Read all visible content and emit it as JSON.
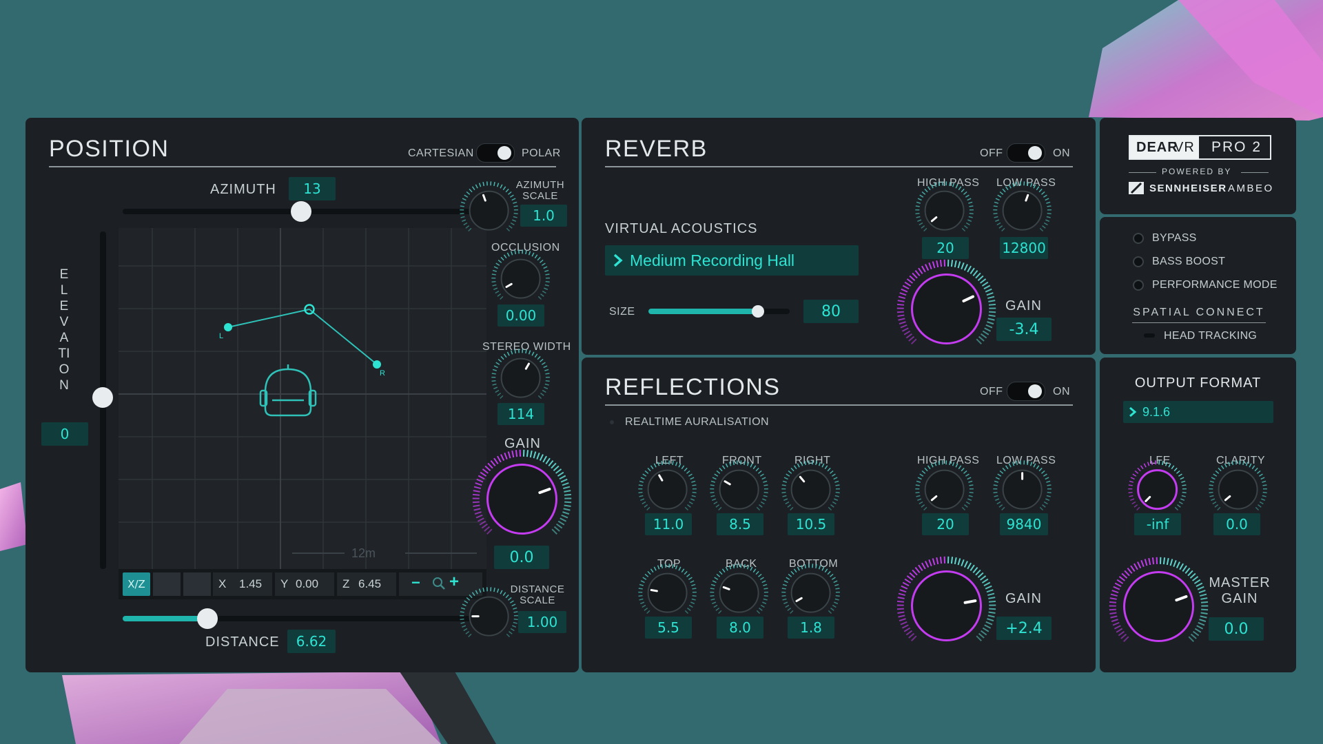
{
  "position": {
    "title": "POSITION",
    "mode_left": "CARTESIAN",
    "mode_right": "POLAR",
    "azimuth_label": "AZIMUTH",
    "azimuth_value": "13",
    "azimuth_scale_label": "AZIMUTH SCALE",
    "azimuth_scale_value": "1.0",
    "occlusion_label": "OCCLUSION",
    "occlusion_value": "0.00",
    "stereo_width_label": "STEREO WIDTH",
    "stereo_width_value": "114",
    "gain_label": "GAIN",
    "gain_value": "0.0",
    "distance_scale_label": "DISTANCE SCALE",
    "distance_scale_value": "1.00",
    "distance_label": "DISTANCE",
    "distance_value": "6.62",
    "elevation_label": "ELEVATION",
    "elevation_value": "0",
    "grid_scale": "12m",
    "view_button": "X/Z",
    "x_label": "X",
    "x_value": "1.45",
    "y_label": "Y",
    "y_value": "0.00",
    "z_label": "Z",
    "z_value": "6.45",
    "zoom_out": "−",
    "zoom_in": "+",
    "left_marker": "L",
    "right_marker": "R"
  },
  "reverb": {
    "title": "REVERB",
    "off": "OFF",
    "on": "ON",
    "virtual_acoustics_label": "VIRTUAL ACOUSTICS",
    "preset": "Medium Recording Hall",
    "size_label": "SIZE",
    "size_value": "80",
    "high_pass_label": "HIGH PASS",
    "high_pass_value": "20",
    "low_pass_label": "LOW PASS",
    "low_pass_value": "12800",
    "gain_label": "GAIN",
    "gain_value": "-3.4"
  },
  "reflections": {
    "title": "REFLECTIONS",
    "off": "OFF",
    "on": "ON",
    "realtime_label": "REALTIME AURALISATION",
    "left_label": "LEFT",
    "left_value": "11.0",
    "front_label": "FRONT",
    "front_value": "8.5",
    "right_label": "RIGHT",
    "right_value": "10.5",
    "top_label": "TOP",
    "top_value": "5.5",
    "back_label": "BACK",
    "back_value": "8.0",
    "bottom_label": "BOTTOM",
    "bottom_value": "1.8",
    "high_pass_label": "HIGH PASS",
    "high_pass_value": "20",
    "low_pass_label": "LOW PASS",
    "low_pass_value": "9840",
    "gain_label": "GAIN",
    "gain_value": "+2.4"
  },
  "brand": {
    "dear": "DEAR",
    "vr": "VR",
    "pro": "PRO 2",
    "powered_by": "POWERED BY",
    "sennheiser": "SENNHEISER",
    "ambeo": "AMBEO"
  },
  "options": {
    "bypass": "BYPASS",
    "bass_boost": "BASS BOOST",
    "performance_mode": "PERFORMANCE MODE",
    "spatial_connect": "SPATIAL CONNECT",
    "head_tracking": "HEAD TRACKING"
  },
  "output": {
    "title": "OUTPUT FORMAT",
    "format": "9.1.6",
    "lfe_label": "LFE",
    "lfe_value": "-inf",
    "clarity_label": "CLARITY",
    "clarity_value": "0.0",
    "master_gain_label": "MASTER GAIN",
    "master_gain_value": "0.0"
  },
  "colors": {
    "accent_teal": "#2ee3d2",
    "accent_magenta": "#c43cf0",
    "panel_bg": "#1c1f23",
    "background": "#326a70"
  }
}
